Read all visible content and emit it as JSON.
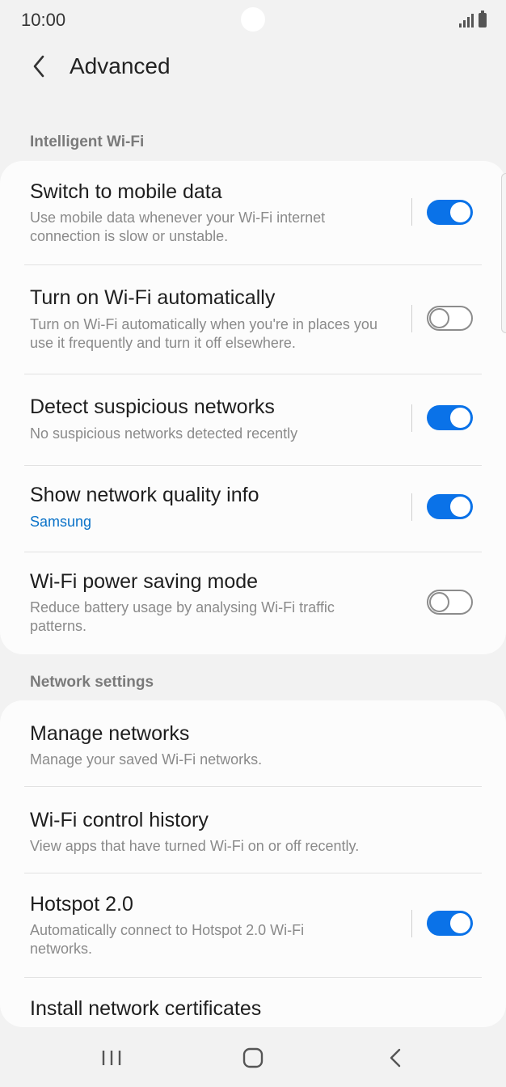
{
  "status": {
    "time": "10:00"
  },
  "header": {
    "title": "Advanced"
  },
  "sections": {
    "intelligent": "Intelligent Wi-Fi",
    "network": "Network settings"
  },
  "rows": {
    "switch_mobile": {
      "title": "Switch to mobile data",
      "subtitle": "Use mobile data whenever your Wi-Fi internet connection is slow or unstable.",
      "enabled": true
    },
    "turn_on_auto": {
      "title": "Turn on Wi-Fi automatically",
      "subtitle": "Turn on Wi-Fi automatically when you're in places you use it frequently and turn it off elsewhere.",
      "enabled": false
    },
    "detect_suspicious": {
      "title": "Detect suspicious networks",
      "subtitle": "No suspicious networks detected recently",
      "enabled": true
    },
    "network_quality": {
      "title": "Show network quality info",
      "subtitle": "Samsung",
      "enabled": true
    },
    "power_saving": {
      "title": "Wi-Fi power saving mode",
      "subtitle": "Reduce battery usage by analysing Wi-Fi traffic patterns.",
      "enabled": false
    },
    "manage_networks": {
      "title": "Manage networks",
      "subtitle": "Manage your saved Wi-Fi networks."
    },
    "control_history": {
      "title": "Wi-Fi control history",
      "subtitle": "View apps that have turned Wi-Fi on or off recently."
    },
    "hotspot": {
      "title": "Hotspot 2.0",
      "subtitle": "Automatically connect to Hotspot 2.0 Wi-Fi networks.",
      "enabled": true
    },
    "certificates": {
      "title": "Install network certificates"
    }
  },
  "colors": {
    "accent": "#0a72e8",
    "background": "#f2f2f2",
    "card": "#fcfcfc"
  },
  "icons": {
    "back": "chevron-left-icon",
    "nav_recents": "recents-icon",
    "nav_home": "home-icon",
    "nav_back": "back-icon"
  }
}
